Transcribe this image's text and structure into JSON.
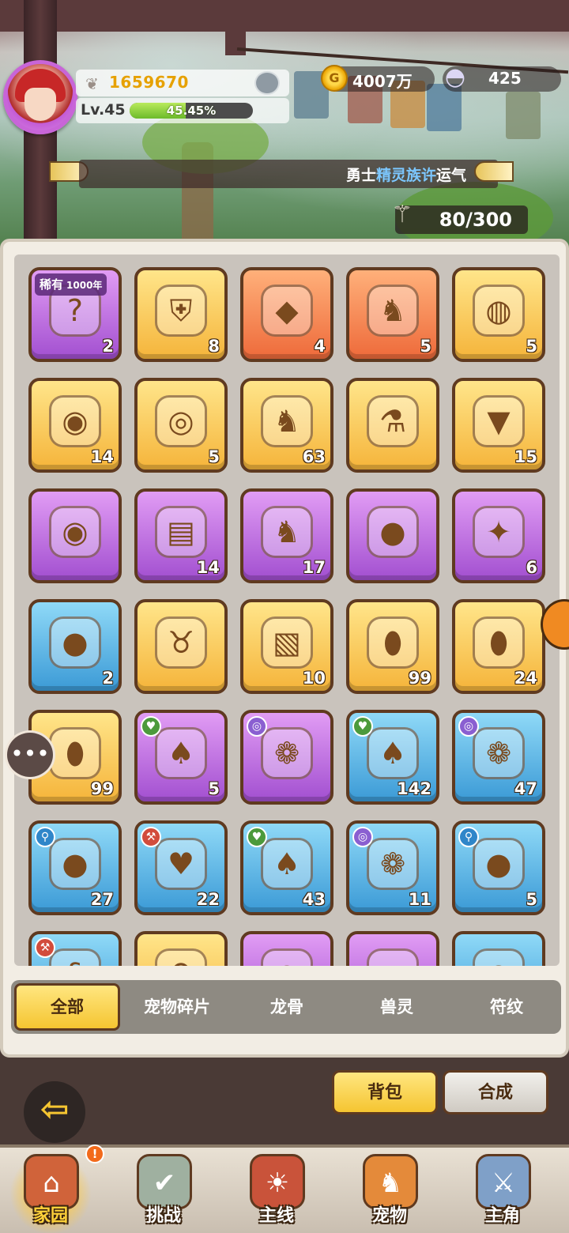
{
  "player": {
    "score": "1659670",
    "level": "Lv.45",
    "exp_percent_text": "45.45%",
    "exp_fraction": 0.4545
  },
  "resources": {
    "coins": "4007万",
    "coin_icon": "coin-icon",
    "shells": "425",
    "shell_icon": "shell-icon"
  },
  "banner": {
    "prefix": "勇士",
    "highlight": "精灵族许",
    "suffix": "运气"
  },
  "capacity": "80/300",
  "rare_badge": {
    "label": "稀有",
    "year": "1000年"
  },
  "items": [
    {
      "count": "2",
      "color": "purple",
      "icon": "mystery-box-icon",
      "rare": true
    },
    {
      "count": "8",
      "color": "gold",
      "icon": "shield-scroll-icon"
    },
    {
      "count": "4",
      "color": "orange",
      "icon": "crystal-icon"
    },
    {
      "count": "5",
      "color": "orange",
      "icon": "dragon-head-icon"
    },
    {
      "count": "5",
      "color": "gold",
      "icon": "shell-coin-icon"
    },
    {
      "count": "14",
      "color": "gold",
      "icon": "rune-stone-icon"
    },
    {
      "count": "5",
      "color": "gold",
      "icon": "rune-coin-icon"
    },
    {
      "count": "63",
      "color": "gold",
      "icon": "dragon-head-icon"
    },
    {
      "count": "",
      "color": "gold",
      "icon": "potion-icon"
    },
    {
      "count": "15",
      "color": "gold",
      "icon": "drill-icon"
    },
    {
      "count": "",
      "color": "purple",
      "icon": "rune-stone-icon"
    },
    {
      "count": "14",
      "color": "purple",
      "icon": "map-scroll-icon"
    },
    {
      "count": "17",
      "color": "purple",
      "icon": "dragon-head-icon"
    },
    {
      "count": "",
      "color": "purple",
      "icon": "spirit-orb-icon"
    },
    {
      "count": "6",
      "color": "purple",
      "icon": "fire-gem-icon"
    },
    {
      "count": "2",
      "color": "blue",
      "icon": "spirit-orb-icon"
    },
    {
      "count": "",
      "color": "gold",
      "icon": "boar-icon"
    },
    {
      "count": "10",
      "color": "gold",
      "icon": "shell-card-icon"
    },
    {
      "count": "99",
      "color": "gold",
      "icon": "egg-icon"
    },
    {
      "count": "24",
      "color": "gold",
      "icon": "egg-icon"
    },
    {
      "count": "99",
      "color": "gold",
      "icon": "egg-icon"
    },
    {
      "count": "5",
      "color": "purple",
      "icon": "pear-icon",
      "tag": "green"
    },
    {
      "count": "",
      "color": "purple",
      "icon": "grape-icon",
      "tag": "purple"
    },
    {
      "count": "142",
      "color": "blue",
      "icon": "pear-icon",
      "tag": "green"
    },
    {
      "count": "47",
      "color": "blue",
      "icon": "grape-icon",
      "tag": "purple"
    },
    {
      "count": "27",
      "color": "blue",
      "icon": "blue-fruit-icon",
      "tag": "cyan"
    },
    {
      "count": "22",
      "color": "blue",
      "icon": "cherry-icon",
      "tag": "red"
    },
    {
      "count": "43",
      "color": "blue",
      "icon": "pear-icon",
      "tag": "green"
    },
    {
      "count": "11",
      "color": "blue",
      "icon": "grape-icon",
      "tag": "purple"
    },
    {
      "count": "5",
      "color": "blue",
      "icon": "blue-fruit-icon",
      "tag": "cyan"
    },
    {
      "count": "",
      "color": "blue",
      "icon": "vine-icon",
      "tag": "red"
    },
    {
      "count": "",
      "color": "gold",
      "icon": "meat-leg-icon"
    },
    {
      "count": "",
      "color": "purple",
      "icon": "steak-icon"
    },
    {
      "count": "",
      "color": "purple",
      "icon": "ribs-icon"
    },
    {
      "count": "",
      "color": "blue",
      "icon": "meat-plate-icon"
    }
  ],
  "tabs": [
    "全部",
    "宠物碎片",
    "龙骨",
    "兽灵",
    "符纹"
  ],
  "active_tab": 0,
  "actions": {
    "bag": "背包",
    "craft": "合成"
  },
  "nav": [
    {
      "label": "家园",
      "icon": "home-icon",
      "active": true,
      "badge": "!"
    },
    {
      "label": "挑战",
      "icon": "challenge-icon"
    },
    {
      "label": "主线",
      "icon": "mainline-icon"
    },
    {
      "label": "宠物",
      "icon": "pet-icon"
    },
    {
      "label": "主角",
      "icon": "hero-icon"
    }
  ],
  "colors": {
    "gold": "#f5b43a",
    "orange": "#ee6a3a",
    "purple": "#a24fd0",
    "blue": "#3b9ad6",
    "score": "#e6a100"
  }
}
